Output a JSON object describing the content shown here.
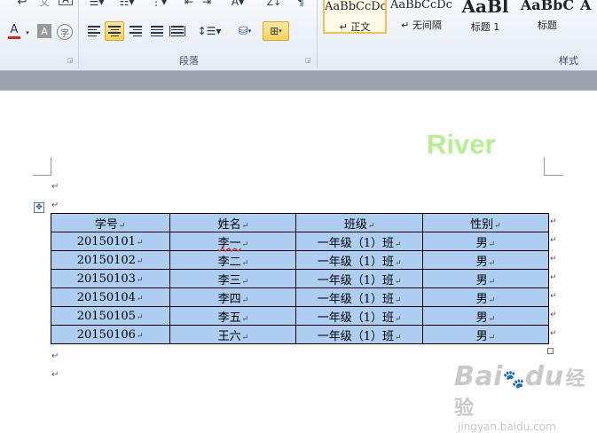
{
  "ribbon": {
    "paragraph_group_label": "段落",
    "styles_group_label": "样式",
    "styles": [
      {
        "sample": "AaBbCcDc",
        "name": "↵ 正文"
      },
      {
        "sample": "AaBbCcDc",
        "name": "↵ 无间隔"
      },
      {
        "sample": "AaBl",
        "name": "标题 1"
      },
      {
        "sample": "AaBbC",
        "name": "标题"
      },
      {
        "sample": "A",
        "name": ""
      }
    ],
    "font_row": {
      "wen": "文",
      "a_box": "A",
      "font_color_a": "A",
      "shading_a": "A",
      "circle_char": "字"
    },
    "sort_label": "Z↓"
  },
  "document": {
    "header_text": "River",
    "para_mark": "↵",
    "table": {
      "headers": [
        "学号",
        "姓名",
        "班级",
        "性别"
      ],
      "rows": [
        [
          "20150101",
          "李一",
          "一年级（1）班",
          "男"
        ],
        [
          "20150102",
          "李二",
          "一年级（1）班",
          "男"
        ],
        [
          "20150103",
          "李三",
          "一年级（1）班",
          "男"
        ],
        [
          "20150104",
          "李四",
          "一年级（1）班",
          "男"
        ],
        [
          "20150105",
          "李五",
          "一年级（1）班",
          "男"
        ],
        [
          "20150106",
          "王六",
          "一年级（1）班",
          "男"
        ]
      ]
    }
  },
  "watermark": {
    "logo": "Bai",
    "logo_end": "du",
    "jingyan": "经验",
    "url": "jingyan.baidu.com"
  },
  "colors": {
    "table_fill": "#adcdf1",
    "header_text": "#b5f08f",
    "highlight_button": "#f9d35a"
  },
  "icons": [
    "align-left-icon",
    "align-center-icon",
    "align-right-icon",
    "justify-icon",
    "distributed-icon",
    "line-spacing-icon",
    "shading-icon",
    "border-icon",
    "table-move-icon"
  ]
}
